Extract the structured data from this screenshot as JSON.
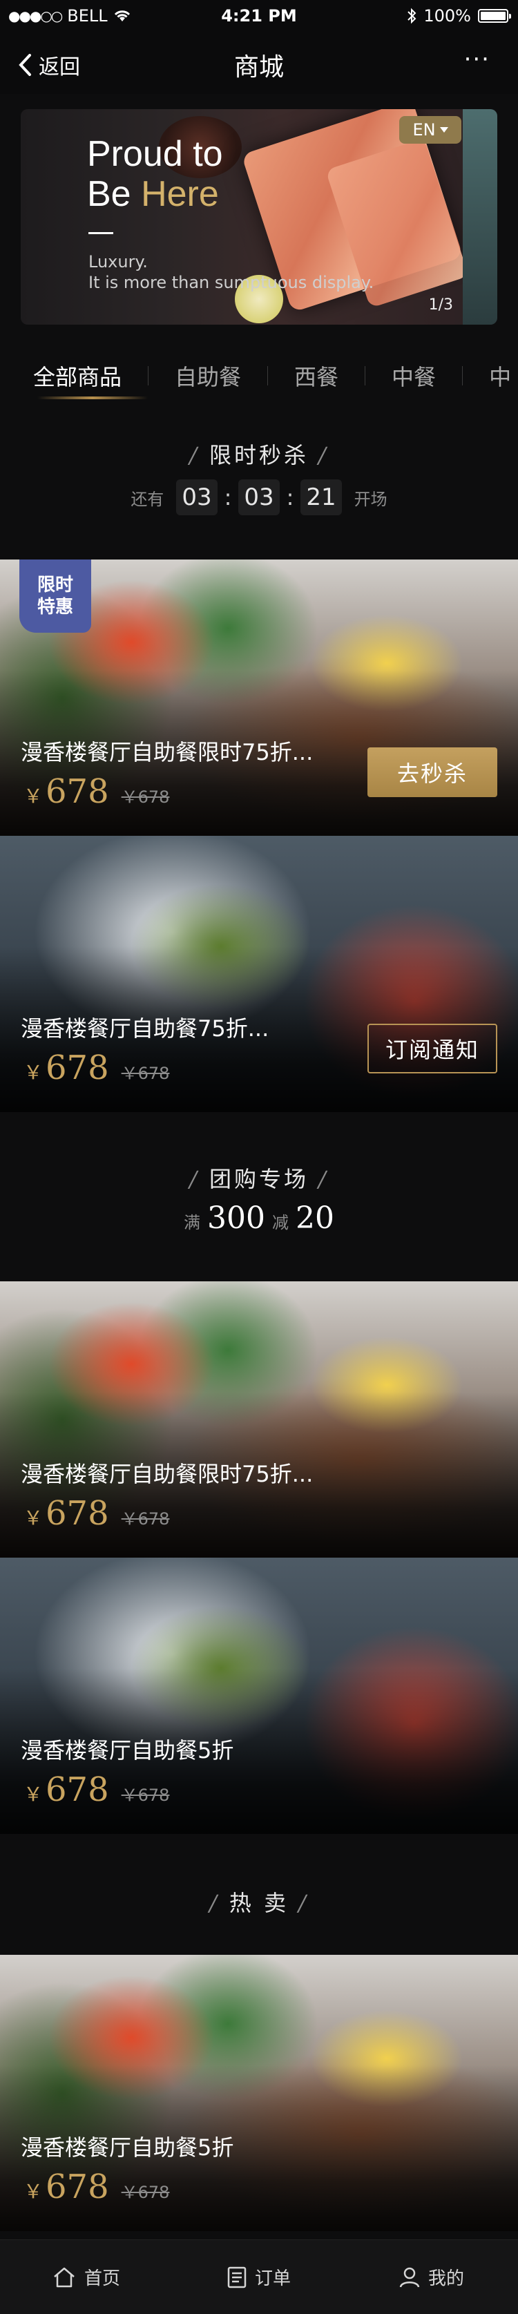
{
  "status_bar": {
    "carrier": "BELL",
    "signal": "●●●○○",
    "time": "4:21 PM",
    "battery": "100%"
  },
  "nav": {
    "back_label": "返回",
    "title": "商城",
    "more": "···"
  },
  "banner": {
    "headline_line1": "Proud to",
    "headline_line2_a": "Be ",
    "headline_line2_b": "Here",
    "sub_line1": "Luxury.",
    "sub_line2": "It is more than sumptuous display.",
    "lang": "EN",
    "page_indicator": "1/3"
  },
  "tabs": [
    "全部商品",
    "自助餐",
    "西餐",
    "中餐",
    "中"
  ],
  "flash_sale": {
    "title": "限时秒杀",
    "prefix": "还有",
    "hours": "03",
    "minutes": "03",
    "seconds": "21",
    "suffix": "开场",
    "items": [
      {
        "badge_line1": "限时",
        "badge_line2": "特惠",
        "name": "漫香楼餐厅自助餐限时75折...",
        "price": "678",
        "yen": "￥",
        "old_price": "￥678",
        "button": "去秒杀"
      },
      {
        "name": "漫香楼餐厅自助餐75折...",
        "price": "678",
        "yen": "￥",
        "old_price": "￥678",
        "button": "订阅通知"
      }
    ]
  },
  "group_buy": {
    "title": "团购专场",
    "promo_full": "满",
    "promo_full_amount": "300",
    "promo_minus": "减",
    "promo_minus_amount": "20",
    "items": [
      {
        "name": "漫香楼餐厅自助餐限时75折...",
        "price": "678",
        "yen": "￥",
        "old_price": "￥678"
      },
      {
        "name": "漫香楼餐厅自助餐5折",
        "price": "678",
        "yen": "￥",
        "old_price": "￥678"
      }
    ]
  },
  "hot": {
    "title": "热 卖",
    "items": [
      {
        "name": "漫香楼餐厅自助餐5折",
        "price": "678",
        "yen": "￥",
        "old_price": "￥678"
      }
    ]
  },
  "tabbar": [
    {
      "label": "首页",
      "icon": "home-icon"
    },
    {
      "label": "订单",
      "icon": "order-icon"
    },
    {
      "label": "我的",
      "icon": "user-icon"
    }
  ],
  "colors": {
    "gold": "#c9a45f",
    "badge": "#4d5aa2",
    "background": "#0d0d0e"
  }
}
